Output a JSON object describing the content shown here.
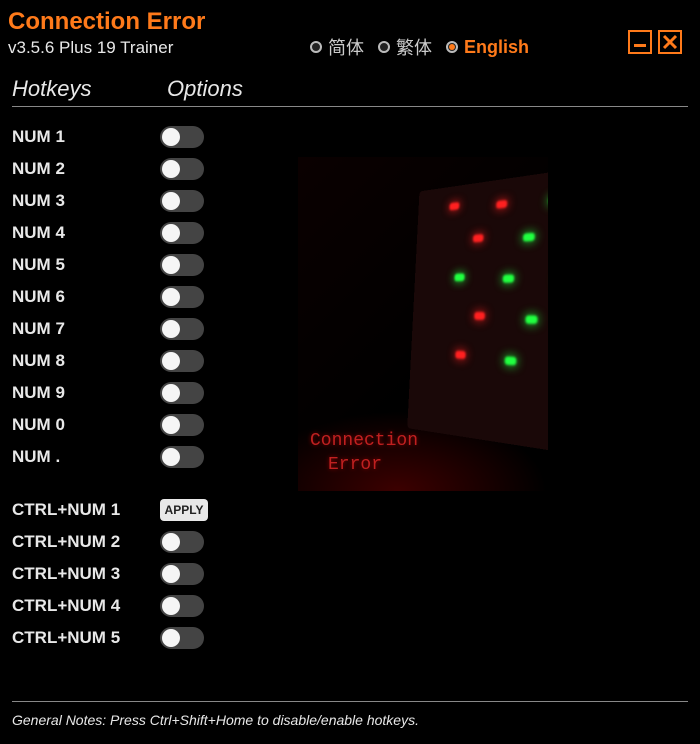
{
  "title": "Connection Error",
  "subtitle": "v3.5.6 Plus 19 Trainer",
  "languages": [
    {
      "label": "简体",
      "selected": false
    },
    {
      "label": "繁体",
      "selected": false
    },
    {
      "label": "English",
      "selected": true
    }
  ],
  "headers": {
    "hotkeys": "Hotkeys",
    "options": "Options"
  },
  "hotkeys_group1": [
    {
      "key": "NUM 1",
      "control": "toggle"
    },
    {
      "key": "NUM 2",
      "control": "toggle"
    },
    {
      "key": "NUM 3",
      "control": "toggle"
    },
    {
      "key": "NUM 4",
      "control": "toggle"
    },
    {
      "key": "NUM 5",
      "control": "toggle"
    },
    {
      "key": "NUM 6",
      "control": "toggle"
    },
    {
      "key": "NUM 7",
      "control": "toggle"
    },
    {
      "key": "NUM 8",
      "control": "toggle"
    },
    {
      "key": "NUM 9",
      "control": "toggle"
    },
    {
      "key": "NUM 0",
      "control": "toggle"
    },
    {
      "key": "NUM .",
      "control": "toggle"
    }
  ],
  "hotkeys_group2": [
    {
      "key": "CTRL+NUM 1",
      "control": "apply"
    },
    {
      "key": "CTRL+NUM 2",
      "control": "toggle"
    },
    {
      "key": "CTRL+NUM 3",
      "control": "toggle"
    },
    {
      "key": "CTRL+NUM 4",
      "control": "toggle"
    },
    {
      "key": "CTRL+NUM 5",
      "control": "toggle"
    }
  ],
  "apply_label": "APPLY",
  "promo": {
    "line1": "Connection",
    "line2": "Error"
  },
  "footer": "General Notes: Press Ctrl+Shift+Home to disable/enable hotkeys."
}
